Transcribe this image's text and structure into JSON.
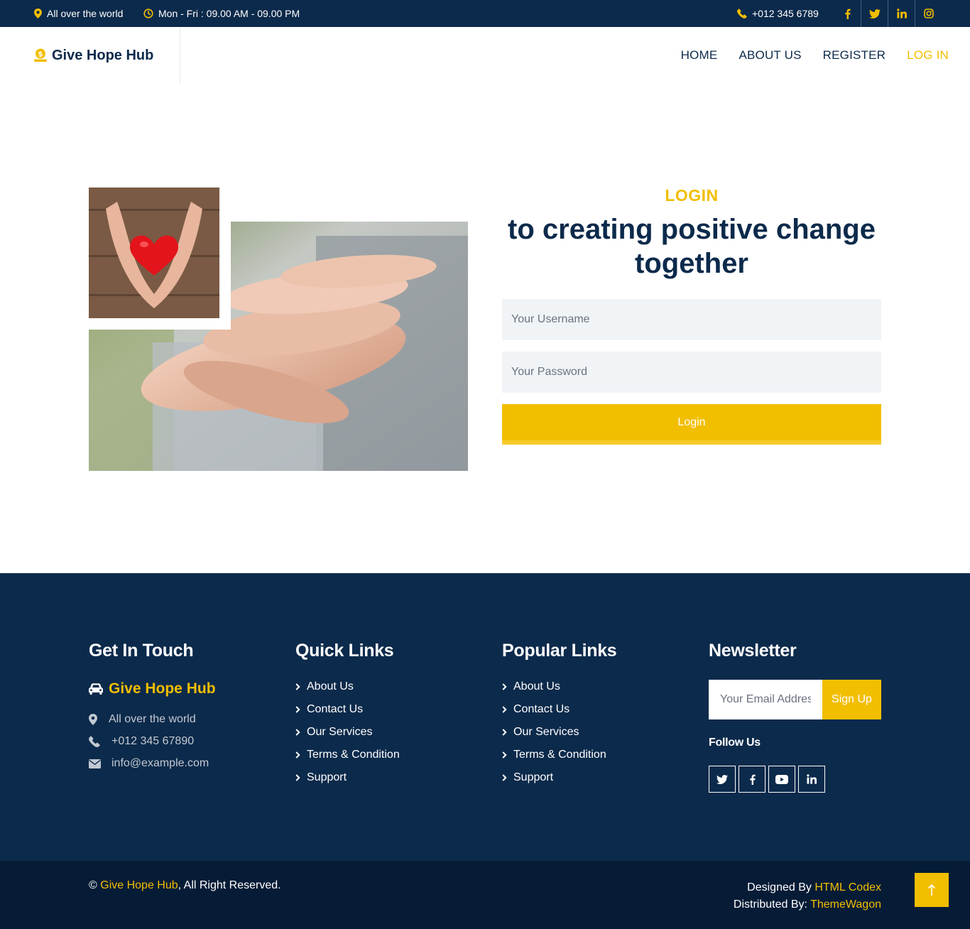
{
  "topbar": {
    "location": "All over the world",
    "hours": "Mon - Fri : 09.00 AM - 09.00 PM",
    "phone": "+012 345 6789",
    "socials": [
      "facebook-icon",
      "twitter-icon",
      "linkedin-icon",
      "instagram-icon"
    ]
  },
  "nav": {
    "brand": "Give Hope Hub",
    "items": [
      {
        "label": "HOME",
        "active": false
      },
      {
        "label": "ABOUT US",
        "active": false
      },
      {
        "label": "REGISTER",
        "active": false
      },
      {
        "label": "LOG IN",
        "active": true
      }
    ]
  },
  "login": {
    "subtitle": "LOGIN",
    "title_line1": "to creating positive change",
    "title_line2": "together",
    "username_placeholder": "Your Username",
    "password_placeholder": "Your Password",
    "button_label": "Login"
  },
  "footer": {
    "get_in_touch": {
      "heading": "Get In Touch",
      "brand": "Give Hope Hub",
      "location": "All over the world",
      "phone": "+012 345 67890",
      "email": "info@example.com"
    },
    "quick_links": {
      "heading": "Quick Links",
      "items": [
        "About Us",
        "Contact Us",
        "Our Services",
        "Terms & Condition",
        "Support"
      ]
    },
    "popular_links": {
      "heading": "Popular Links",
      "items": [
        "About Us",
        "Contact Us",
        "Our Services",
        "Terms & Condition",
        "Support"
      ]
    },
    "newsletter": {
      "heading": "Newsletter",
      "email_placeholder": "Your Email Address",
      "signup_label": "Sign Up",
      "follow_label": "Follow Us",
      "socials": [
        "twitter-icon",
        "facebook-icon",
        "youtube-icon",
        "linkedin-icon"
      ]
    }
  },
  "copyright": {
    "symbol": "©",
    "site": "Give Hope Hub",
    "rights": ", All Right Reserved.",
    "designed_prefix": "Designed By",
    "designed_by": "HTML Codex",
    "distributed_prefix": "Distributed By:",
    "distributed_by": "ThemeWagon"
  },
  "colors": {
    "navy": "#0c2a4b",
    "accent": "#f2be00",
    "dark": "#061c36"
  }
}
